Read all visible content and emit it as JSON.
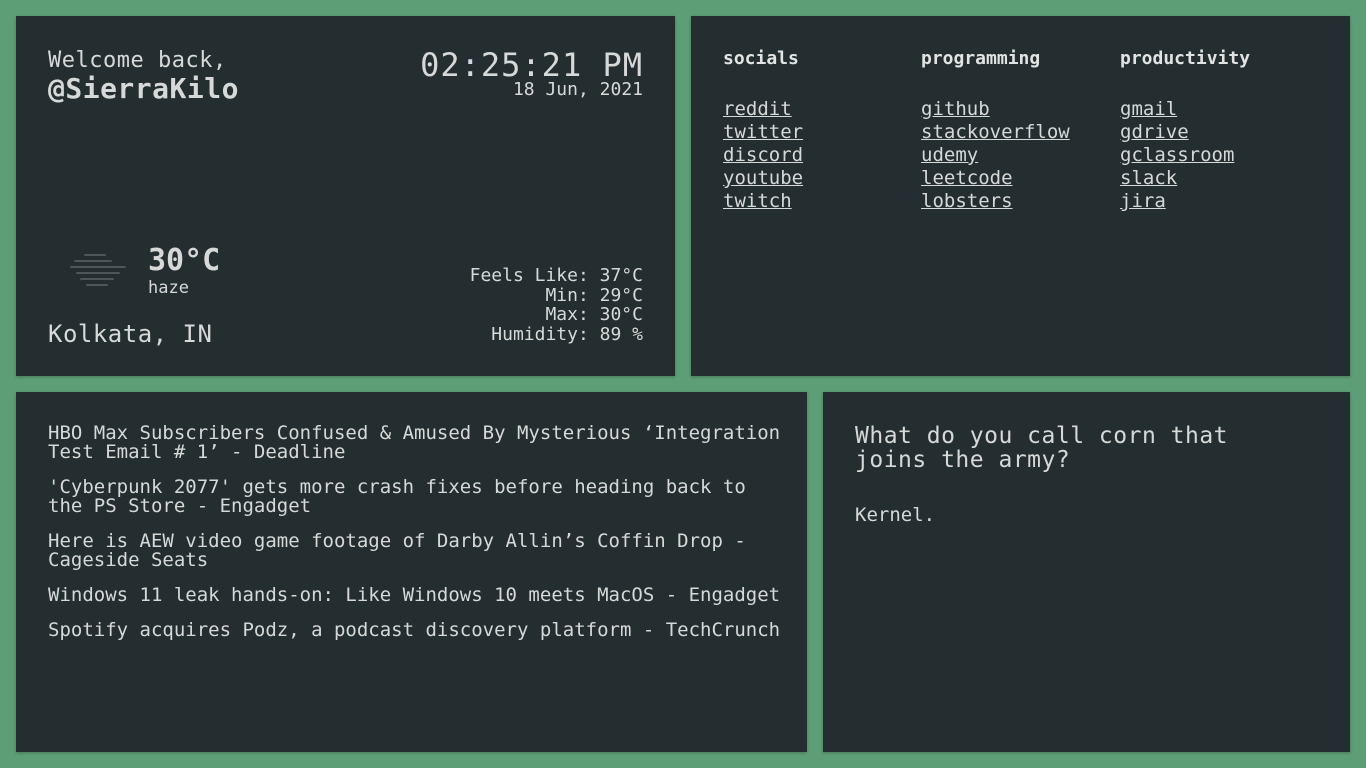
{
  "welcome": {
    "greeting": "Welcome back,",
    "username": "@SierraKilo",
    "time": "02:25:21 PM",
    "date": "18 Jun, 2021"
  },
  "weather": {
    "icon": "haze-icon",
    "temperature": "30°C",
    "condition": "haze",
    "location": "Kolkata, IN",
    "feels_like": "Feels Like: 37°C",
    "min": "Min: 29°C",
    "max": "Max: 30°C",
    "humidity": "Humidity: 89 %"
  },
  "links": {
    "columns": [
      {
        "title": "socials",
        "items": [
          "reddit",
          "twitter",
          "discord",
          "youtube",
          "twitch"
        ]
      },
      {
        "title": "programming",
        "items": [
          "github",
          "stackoverflow",
          "udemy",
          "leetcode",
          "lobsters"
        ]
      },
      {
        "title": "productivity",
        "items": [
          "gmail",
          "gdrive",
          "gclassroom",
          "slack",
          "jira"
        ]
      }
    ]
  },
  "news": {
    "items": [
      "HBO Max Subscribers Confused & Amused By Mysterious ‘Integration Test Email # 1’ - Deadline",
      "'Cyberpunk 2077' gets more crash fixes before heading back to the PS Store - Engadget",
      "Here is AEW video game footage of Darby Allin’s Coffin Drop - Cageside Seats",
      "Windows 11 leak hands-on: Like Windows 10 meets MacOS - Engadget",
      "Spotify acquires Podz, a podcast discovery platform - TechCrunch"
    ]
  },
  "joke": {
    "question": "What do you call corn that joins the army?",
    "answer": "Kernel."
  },
  "colors": {
    "background": "#5e9e76",
    "card": "#242e30",
    "text": "#d7d9d8"
  }
}
